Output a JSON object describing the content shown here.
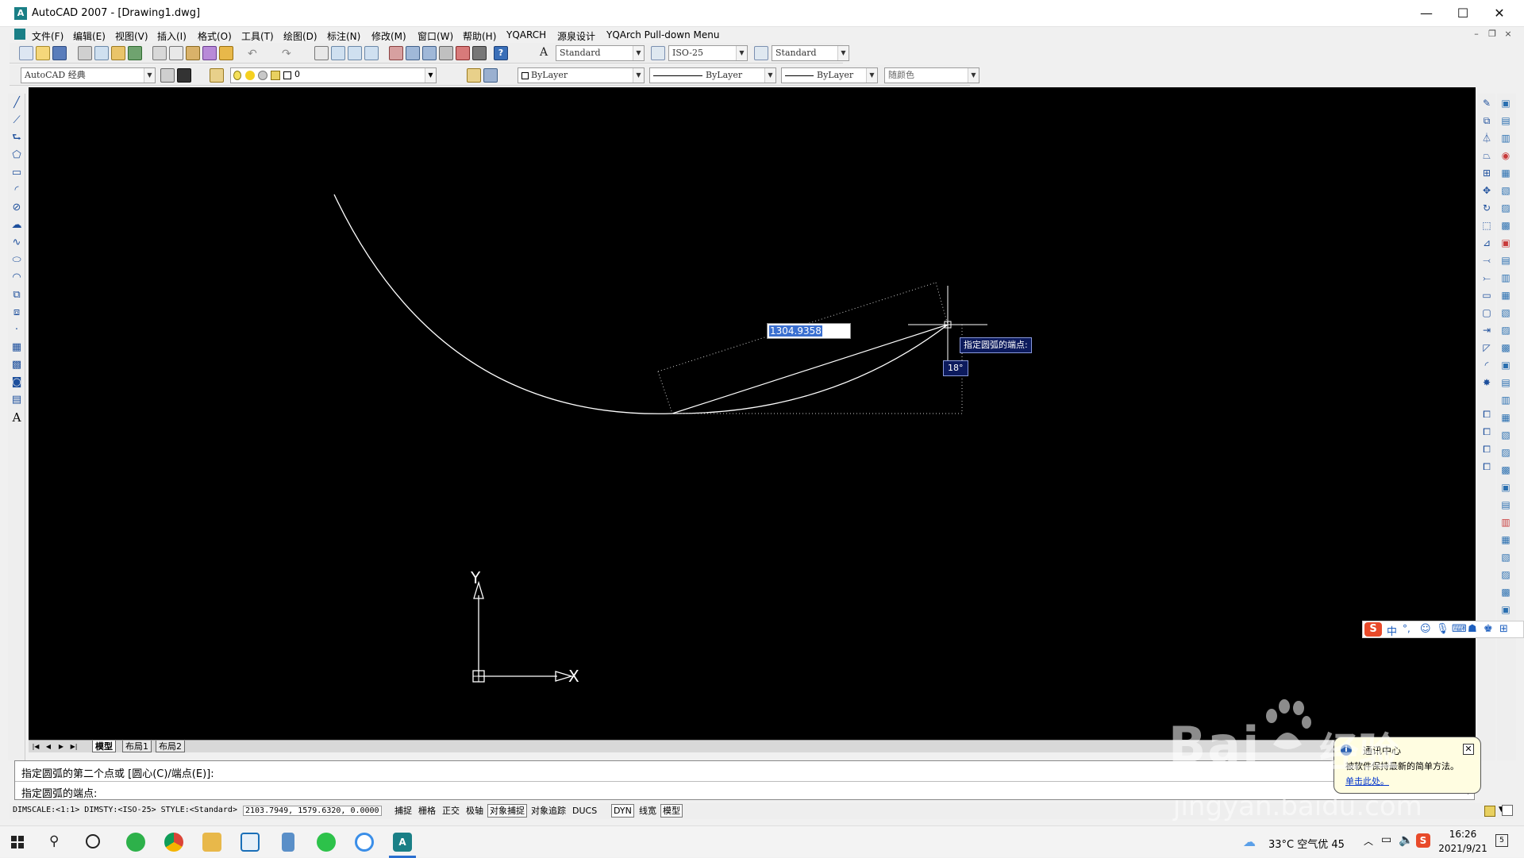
{
  "window": {
    "title": "AutoCAD 2007 - [Drawing1.dwg]",
    "min": "—",
    "max": "☐",
    "close": "✕"
  },
  "menu": {
    "items": [
      "文件(F)",
      "编辑(E)",
      "视图(V)",
      "插入(I)",
      "格式(O)",
      "工具(T)",
      "绘图(D)",
      "标注(N)",
      "修改(M)",
      "窗口(W)",
      "帮助(H)",
      "YQARCH",
      "源泉设计",
      "YQArch Pull-down Menu"
    ]
  },
  "toolbar1": {
    "text_style": "Standard",
    "dim_style": "ISO-25",
    "table_style": "Standard"
  },
  "toolbar2": {
    "workspace": "AutoCAD 经典",
    "layer": "0",
    "color": "ByLayer",
    "linetype": "ByLayer",
    "lineweight": "ByLayer",
    "plotstyle": "随颜色"
  },
  "canvas": {
    "dynamic_input_value": "1304.9358",
    "prompt_tooltip": "指定圆弧的端点:",
    "angle": "18°",
    "ucs_x": "X",
    "ucs_y": "Y"
  },
  "tabs": {
    "items": [
      "模型",
      "布局1",
      "布局2"
    ],
    "active": "模型"
  },
  "command": {
    "line1": "指定圆弧的第二个点或 [圆心(C)/端点(E)]:",
    "line2": "指定圆弧的端点:"
  },
  "status": {
    "info": "DIMSCALE:<1:1> DIMSTY:<ISO-25> STYLE:<Standard>",
    "coords": "2103.7949,  1579.6320, 0.0000",
    "toggles": [
      {
        "label": "捕捉",
        "on": false
      },
      {
        "label": "栅格",
        "on": false
      },
      {
        "label": "正交",
        "on": false
      },
      {
        "label": "极轴",
        "on": false
      },
      {
        "label": "对象捕捉",
        "on": true
      },
      {
        "label": "对象追踪",
        "on": false
      },
      {
        "label": "DUCS",
        "on": false
      },
      {
        "label": "DYN",
        "on": true
      },
      {
        "label": "线宽",
        "on": false
      },
      {
        "label": "模型",
        "on": true
      }
    ]
  },
  "balloon": {
    "title": "通讯中心",
    "body": "被软件保持最新的简单方法。",
    "link": "单击此处。"
  },
  "watermark": {
    "brand": "Bai",
    "brand2": "经验",
    "url": "jingyan.baidu.com"
  },
  "ime": {
    "label": "中"
  },
  "taskbar": {
    "weather": "33°C 空气优 45",
    "time": "16:26",
    "date": "2021/9/21",
    "notifications": "5"
  }
}
